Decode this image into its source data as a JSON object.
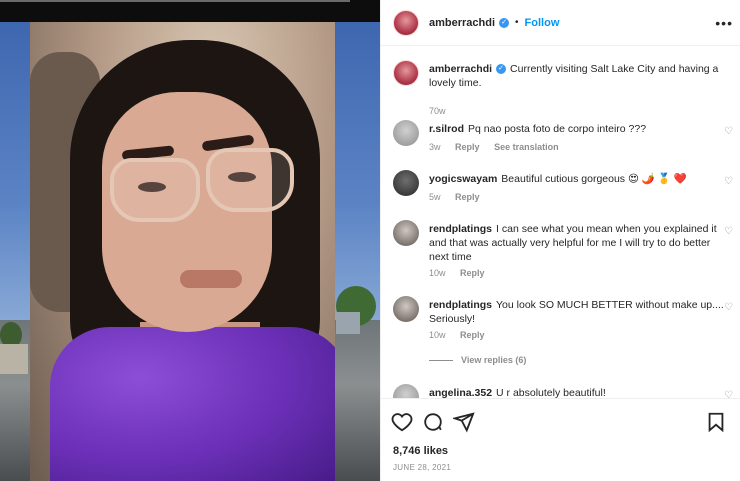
{
  "post": {
    "username": "amberrachdi",
    "follow_label": "Follow",
    "more_label": "•••",
    "likes": "8,746 likes",
    "date": "JUNE 28, 2021"
  },
  "comments": [
    {
      "username": "amberrachdi",
      "text": "Currently visiting Salt Lake City and having a lovely time.",
      "time": "70w",
      "is_caption": true
    },
    {
      "username": "r.silrod",
      "text": "Pq nao posta foto de corpo inteiro ???",
      "time": "3w",
      "reply": "Reply",
      "translation": "See translation"
    },
    {
      "username": "yogicswayam",
      "text": "Beautiful cutious gorgeous 😍 🌶️ 🥇 ❤️",
      "time": "5w",
      "reply": "Reply"
    },
    {
      "username": "rendplatings",
      "text": "I can see what you mean when you explained it and that was actually very helpful for me I will try to do better next time",
      "time": "10w",
      "reply": "Reply"
    },
    {
      "username": "rendplatings",
      "text": "You look SO MUCH BETTER without make up.... Seriously!",
      "time": "10w",
      "reply": "Reply",
      "view_replies": "View replies (6)"
    },
    {
      "username": "angelina.352",
      "text": "U r absolutely beautiful!"
    }
  ],
  "icons": [
    "heart-icon",
    "comment-icon",
    "share-icon",
    "bookmark-icon",
    "more-icon",
    "verified-badge-icon"
  ],
  "colors": {
    "accent": "#0095f6",
    "verified": "#3897f0",
    "muted": "#8e8e8e",
    "text": "#262626"
  }
}
